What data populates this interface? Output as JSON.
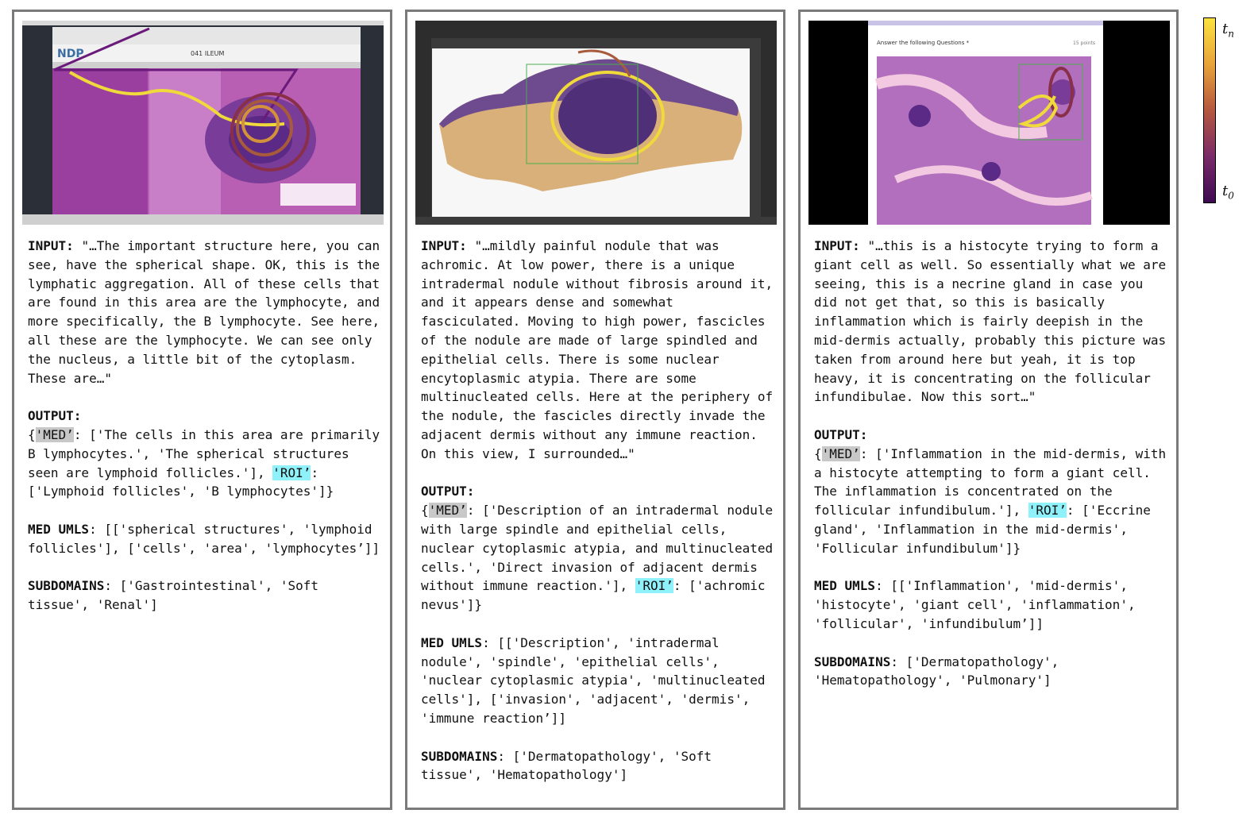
{
  "colorbar": {
    "top_label_base": "t",
    "top_label_sub": "n",
    "bottom_label_base": "t",
    "bottom_label_sub": "0",
    "gradient": [
      "#fbe23f",
      "#e8a33a",
      "#b5573f",
      "#7a2a68",
      "#3d0a52"
    ]
  },
  "colors": {
    "med_highlight": "#c8c8c8",
    "roi_highlight": "#8ff1fa",
    "border": "#7a7a7a"
  },
  "panels": [
    {
      "image": {
        "slide_title": "041 ILEUM",
        "logo_text": "NDP",
        "icon": "histology-screen-with-gaze-trace"
      },
      "input_label": "INPUT:",
      "input_text": "\"…The important structure here, you can see, have the spherical shape. OK, this is the lymphatic aggregation. All of these cells that are found in this area are the lymphocyte, and more specifically, the B lymphocyte. See here, all these are the lymphocyte. We can see only the nucleus, a little bit of the cytoplasm. These are…\"",
      "output_label": "OUTPUT:",
      "out_open": "{",
      "med_key": "'MED’",
      "med_value": ": ['The cells in this area are primarily B lymphocytes.', 'The spherical structures seen are lymphoid follicles.'],",
      "roi_key": "'ROI’",
      "roi_value": ": ['Lymphoid follicles', 'B lymphocytes']}",
      "umls_label": "MED UMLS",
      "umls_value": ": [['spherical structures', 'lymphoid follicles'], ['cells', 'area', 'lymphocytes’]]",
      "subdomains_label": "SUBDOMAINS",
      "subdomains_value": ": ['Gastrointestinal', 'Soft tissue', 'Renal']"
    },
    {
      "image": {
        "icon": "skin-nodule-slide-with-gaze-trace"
      },
      "input_label": "INPUT:",
      "input_text": "\"…mildly painful nodule that was achromic. At low power, there is a unique intradermal nodule without fibrosis around it, and it appears dense and somewhat fasciculated. Moving to high power, fascicles of the nodule are made of large spindled and epithelial cells. There is some nuclear encytoplasmic atypia. There are some multinucleated cells. Here at the periphery of the nodule, the fascicles directly invade the adjacent dermis without any immune reaction. On this view, I surrounded…\"",
      "output_label": "OUTPUT:",
      "out_open": "{",
      "med_key": "'MED’",
      "med_value": ": ['Description of an intradermal nodule with large spindle and epithelial cells, nuclear cytoplasmic atypia, and multinucleated cells.', 'Direct invasion of adjacent dermis without immune reaction.'],",
      "roi_key": "'ROI’",
      "roi_value": ": ['achromic nevus']}",
      "umls_label": "MED UMLS",
      "umls_value": ": [['Description', 'intradermal nodule', 'spindle', 'epithelial cells', 'nuclear cytoplasmic atypia', 'multinucleated cells'], ['invasion', 'adjacent', 'dermis', 'immune reaction’]]",
      "subdomains_label": "SUBDOMAINS",
      "subdomains_value": ": ['Dermatopathology', 'Soft tissue', 'Hematopathology']"
    },
    {
      "image": {
        "question_text": "Answer the following Questions *",
        "points_text": "15 points",
        "icon": "histology-question-with-gaze-trace"
      },
      "input_label": "INPUT:",
      "input_text": "\"…this is a histocyte trying to form a giant cell as well. So essentially what we are seeing, this is a necrine gland in case you did not get that, so this is basically inflammation which is fairly deepish in the mid-dermis actually, probably this picture was taken from around here but yeah, it is top heavy, it is concentrating on the follicular infundibulae. Now this sort…\"",
      "output_label": "OUTPUT:",
      "out_open": "{",
      "med_key": "'MED’",
      "med_value": ": ['Inflammation in the mid-dermis, with a histocyte attempting to form a giant cell. The inflammation is concentrated on the follicular infundibulum.'],",
      "roi_key": "'ROI’",
      "roi_value": ": ['Eccrine gland', 'Inflammation in the mid-dermis', 'Follicular infundibulum']}",
      "umls_label": "MED UMLS",
      "umls_value": ": [['Inflammation', 'mid-dermis', 'histocyte', 'giant cell', 'inflammation', 'follicular', 'infundibulum’]]",
      "subdomains_label": "SUBDOMAINS",
      "subdomains_value": ": ['Dermatopathology', 'Hematopathology', 'Pulmonary']"
    }
  ]
}
